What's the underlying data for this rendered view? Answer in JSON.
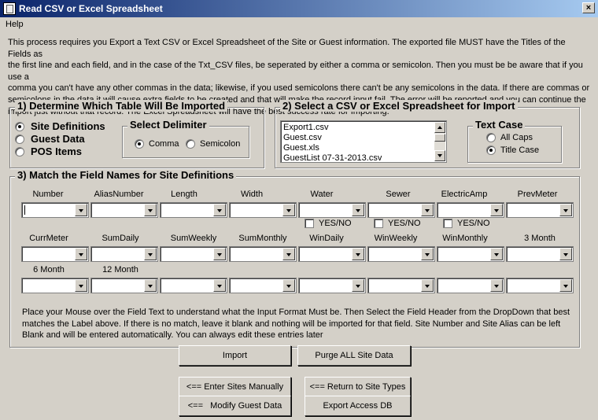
{
  "window": {
    "title": "Read CSV or Excel Spreadsheet",
    "close_glyph": "×"
  },
  "menu": {
    "help": "Help"
  },
  "intro_text": "This process requires you Export a Text CSV or Excel Spreadsheet of the Site or Guest information. The exported file MUST have the Titles of the Fields as\nthe first line and each field, and in the case of the Txt_CSV files, be seperated by either a comma or semicolon.  Then you must be be aware that if you use a\ncomma you can't have any other commas in the data; likewise, if you used semicolons there can't be any semicolons in the data.  If there are commas or\nsemicolons in the data it will cause extra fields to be created and that will make the record input fail.  The error will be reported and you can continue the\nimport just without that record.  The Excel Spreadsheet will have the best success rate for Importing.",
  "section1": {
    "title": "1) Determine Which Table Will Be Imported",
    "tables": [
      {
        "label": "Site Definitions",
        "selected": true
      },
      {
        "label": "Guest Data",
        "selected": false
      },
      {
        "label": "POS Items",
        "selected": false
      }
    ],
    "delimiter": {
      "title": "Select Delimiter",
      "options": [
        {
          "label": "Comma",
          "selected": true
        },
        {
          "label": "Semicolon",
          "selected": false
        }
      ]
    }
  },
  "section2": {
    "title": "2) Select a CSV or Excel Spreadsheet for Import",
    "files": [
      "Export1.csv",
      "Guest.csv",
      "Guest.xls",
      "GuestList 07-31-2013.csv"
    ],
    "text_case": {
      "title": "Text Case",
      "options": [
        {
          "label": "All Caps",
          "selected": false
        },
        {
          "label": "Title Case",
          "selected": true
        }
      ]
    }
  },
  "section3": {
    "title": "3) Match the Field Names for Site Definitions",
    "row1": [
      "Number",
      "AliasNumber",
      "Length",
      "Width",
      "Water",
      "Sewer",
      "ElectricAmp",
      "PrevMeter"
    ],
    "yes_no_label": "YES/NO",
    "row2": [
      "CurrMeter",
      "SumDaily",
      "SumWeekly",
      "SumMonthly",
      "WinDaily",
      "WinWeekly",
      "WinMonthly",
      "3 Month"
    ],
    "row3": [
      "6 Month",
      "12 Month"
    ],
    "help_text": "Place your Mouse over the Field Text to understand what the Input Format Must be.  Then Select the Field Header from the DropDown that best matches the Label above.  If there is no match, leave it blank and nothing will be imported for that field.  Site Number and Site Alias can be left Blank and will be entered automatically.  You can always edit these entries later",
    "import_button": "Import",
    "purge_button": "Purge ALL Site Data"
  },
  "nav": {
    "enter_sites": "<== Enter Sites Manually",
    "return_site_types": "<== Return to Site Types",
    "modify_guest": "<==   Modify Guest Data",
    "export_access": "Export Access DB"
  }
}
